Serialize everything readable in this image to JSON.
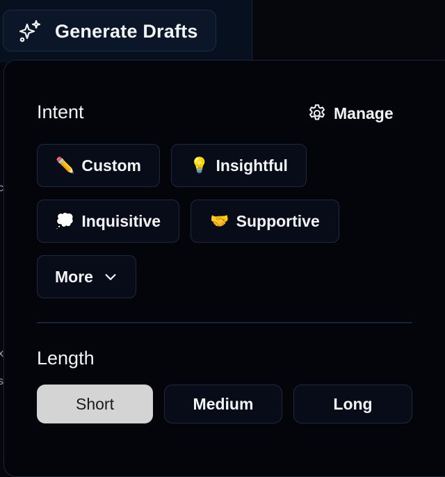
{
  "header": {
    "generate_button_label": "Generate Drafts",
    "generate_icon": "sparkles-icon"
  },
  "intent": {
    "title": "Intent",
    "manage_label": "Manage",
    "manage_icon": "gear-icon",
    "chips": [
      {
        "emoji": "✏️",
        "label": "Custom"
      },
      {
        "emoji": "💡",
        "label": "Insightful"
      },
      {
        "emoji": "💭",
        "label": "Inquisitive"
      },
      {
        "emoji": "🤝",
        "label": "Supportive"
      }
    ],
    "more_label": "More",
    "more_icon": "chevron-down-icon"
  },
  "length": {
    "title": "Length",
    "options": [
      {
        "label": "Short",
        "selected": true
      },
      {
        "label": "Medium",
        "selected": false
      },
      {
        "label": "Long",
        "selected": false
      }
    ]
  },
  "colors": {
    "page_bg": "#05070d",
    "popover_bg": "#04050b",
    "chip_bg": "#070c18",
    "chip_border": "#1f2a3f",
    "selected_bg": "#d4d4d4",
    "text": "#f3f4f6"
  }
}
